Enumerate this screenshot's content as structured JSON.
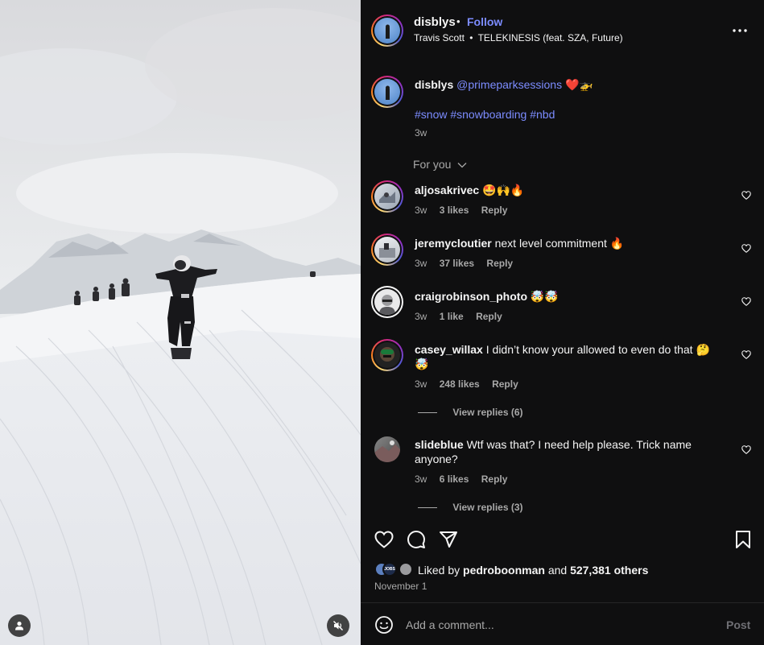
{
  "header": {
    "username": "disblys",
    "dot": "•",
    "follow_label": "Follow",
    "audio_artist": "Travis Scott",
    "audio_sep": "•",
    "audio_title": "TELEKINESIS (feat. SZA, Future)",
    "more_label": "•••"
  },
  "caption": {
    "username": "disblys",
    "mention": "@primeparksessions",
    "emoji": "❤️🚁",
    "hashtags": "#snow #snowboarding #nbd",
    "time": "3w"
  },
  "sort": {
    "label": "For you",
    "chevron": "⌵"
  },
  "comments": [
    {
      "username": "aljosakrivec",
      "text": "🤩🙌🔥",
      "time": "3w",
      "likes": "3 likes",
      "reply": "Reply"
    },
    {
      "username": "jeremycloutier",
      "text": "next level commitment 🔥",
      "time": "3w",
      "likes": "37 likes",
      "reply": "Reply"
    },
    {
      "username": "craigrobinson_photo",
      "text": "🤯🤯",
      "time": "3w",
      "likes": "1 like",
      "reply": "Reply"
    },
    {
      "username": "casey_willax",
      "text": "I didn’t know your allowed to even do that 🤔",
      "text2": "🤯",
      "time": "3w",
      "likes": "248 likes",
      "reply": "Reply",
      "view_replies": "View replies (6)"
    },
    {
      "username": "slideblue",
      "text": "Wtf was that? I need help please. Trick name",
      "text2": "anyone?",
      "time": "3w",
      "likes": "6 likes",
      "reply": "Reply",
      "view_replies": "View replies (3)"
    }
  ],
  "actions": {
    "liked_by_prefix": "Liked by",
    "liked_by_user": "pedroboonman",
    "and": "and",
    "others": "527,381 others",
    "date": "November 1",
    "mini_avatar_text": "JOBS"
  },
  "composer": {
    "placeholder": "Add a comment...",
    "post_label": "Post"
  },
  "icons": {
    "like": "heart-icon",
    "comment": "comment-icon",
    "share": "send-icon",
    "save": "bookmark-icon",
    "emoji": "smiley-icon",
    "user": "person-icon",
    "mute": "speaker-muted-icon"
  },
  "colors": {
    "accent_blue": "#7c8cff",
    "panel_bg": "#0f0f10",
    "muted_text": "#a8a8a8"
  }
}
